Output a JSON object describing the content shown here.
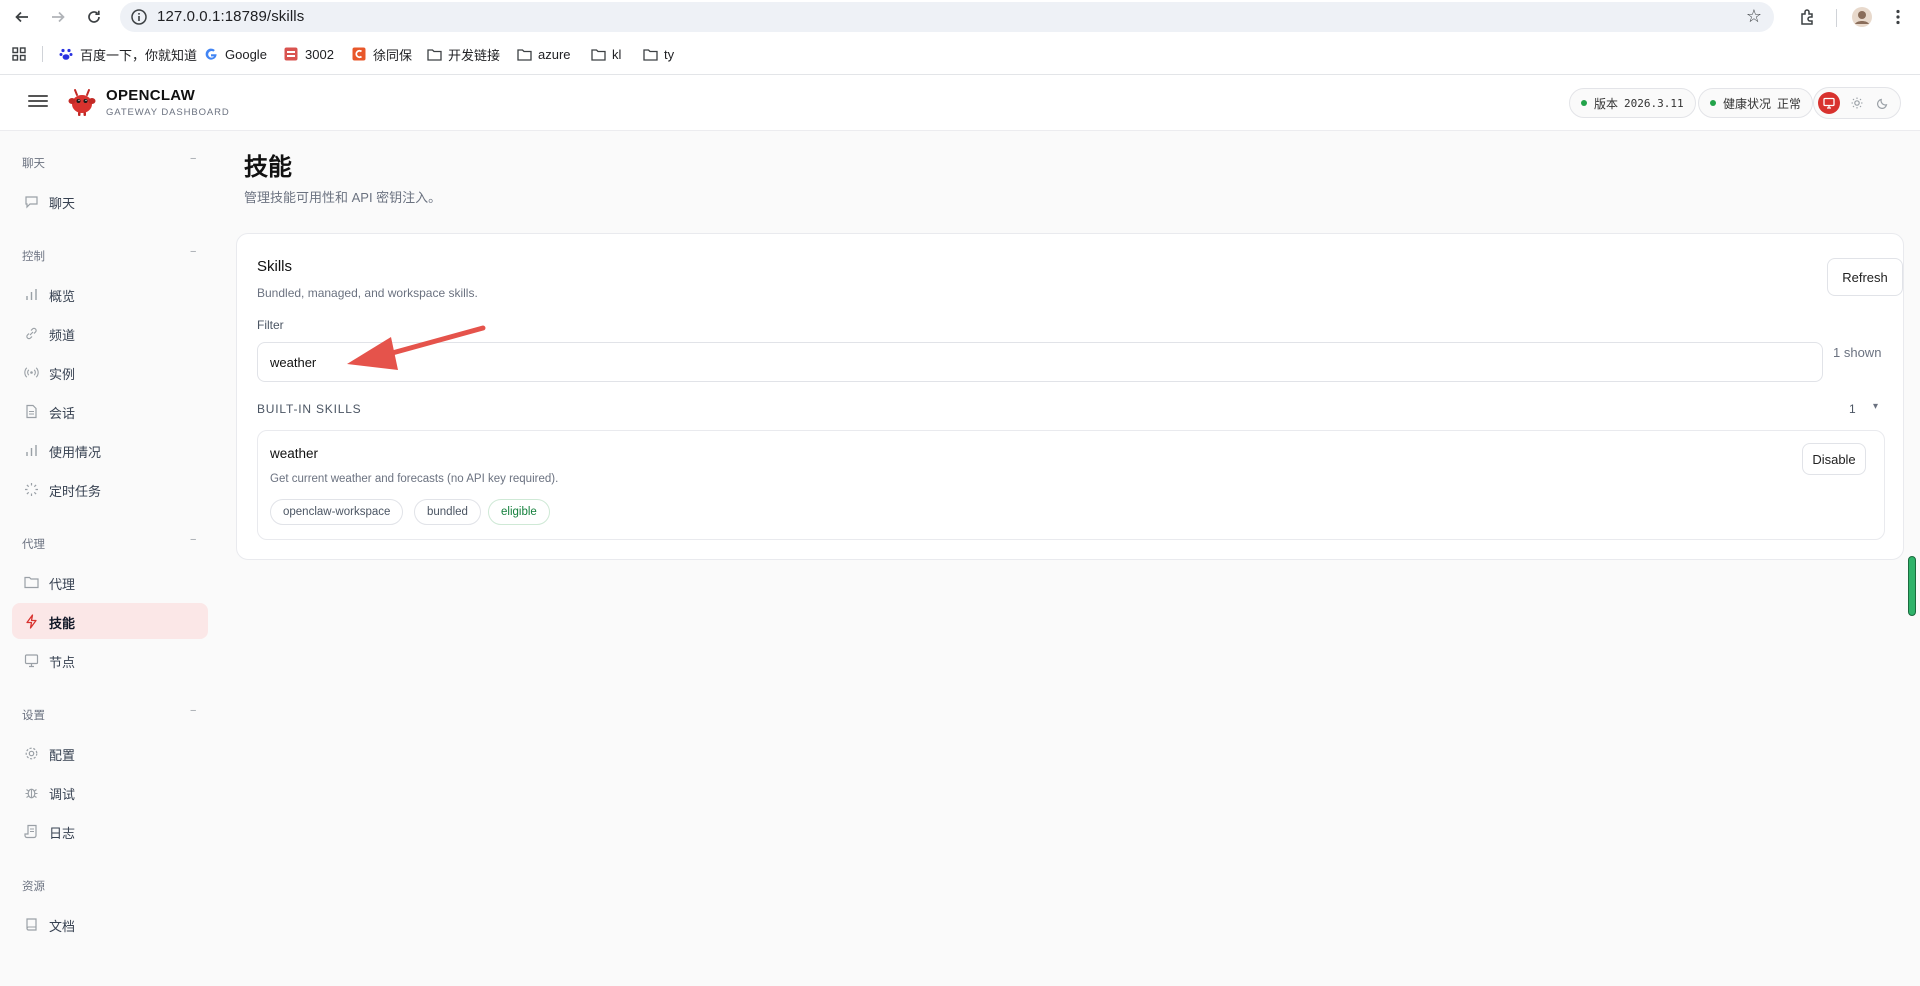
{
  "browser": {
    "url": "127.0.0.1:18789/skills",
    "bookmarks": [
      {
        "label": "百度一下，你就知道",
        "icon": "paw-icon"
      },
      {
        "label": "Google",
        "icon": "google-icon"
      },
      {
        "label": "3002",
        "icon": "app-icon"
      },
      {
        "label": "徐同保",
        "icon": "c-icon"
      },
      {
        "label": "开发链接",
        "icon": "folder-icon"
      },
      {
        "label": "azure",
        "icon": "folder-icon"
      },
      {
        "label": "kl",
        "icon": "folder-icon"
      },
      {
        "label": "ty",
        "icon": "folder-icon"
      }
    ]
  },
  "header": {
    "brand": "OPENCLAW",
    "brand_sub": "GATEWAY DASHBOARD",
    "version_label": "版本",
    "version_value": "2026.3.11",
    "health_label": "健康状况",
    "health_value": "正常"
  },
  "sidebar": {
    "sections": [
      {
        "title": "聊天",
        "collapse": "−",
        "items": [
          {
            "label": "聊天",
            "icon": "chat-icon"
          }
        ]
      },
      {
        "title": "控制",
        "collapse": "−",
        "items": [
          {
            "label": "概览",
            "icon": "bar-chart-icon"
          },
          {
            "label": "频道",
            "icon": "link-icon"
          },
          {
            "label": "实例",
            "icon": "broadcast-icon"
          },
          {
            "label": "会话",
            "icon": "document-icon"
          },
          {
            "label": "使用情况",
            "icon": "bar-chart-icon"
          },
          {
            "label": "定时任务",
            "icon": "loader-icon"
          }
        ]
      },
      {
        "title": "代理",
        "collapse": "−",
        "items": [
          {
            "label": "代理",
            "icon": "folder-icon"
          },
          {
            "label": "技能",
            "icon": "lightning-icon",
            "active": true
          },
          {
            "label": "节点",
            "icon": "monitor-icon"
          }
        ]
      },
      {
        "title": "设置",
        "collapse": "−",
        "items": [
          {
            "label": "配置",
            "icon": "gear-icon"
          },
          {
            "label": "调试",
            "icon": "bug-icon"
          },
          {
            "label": "日志",
            "icon": "scroll-icon"
          }
        ]
      },
      {
        "title": "资源",
        "collapse": "",
        "items": [
          {
            "label": "文档",
            "icon": "book-icon"
          }
        ]
      }
    ]
  },
  "main": {
    "title": "技能",
    "subtitle": "管理技能可用性和 API 密钥注入。",
    "card": {
      "title": "Skills",
      "subtitle": "Bundled, managed, and workspace skills.",
      "refresh_label": "Refresh",
      "filter_label": "Filter",
      "filter_value": "weather",
      "shown": "1 shown",
      "group": {
        "title": "BUILT-IN SKILLS",
        "count": "1",
        "caret": "▾",
        "skills": [
          {
            "name": "weather",
            "description": "Get current weather and forecasts (no API key required).",
            "action": "Disable",
            "tags": [
              "openclaw-workspace",
              "bundled",
              "eligible"
            ]
          }
        ]
      }
    }
  },
  "colors": {
    "accent": "#d8322e",
    "active_bg": "#fbe7e7",
    "ok": "#15803d",
    "health_dot": "#22a34a",
    "annotation_arrow": "#e5534b"
  }
}
